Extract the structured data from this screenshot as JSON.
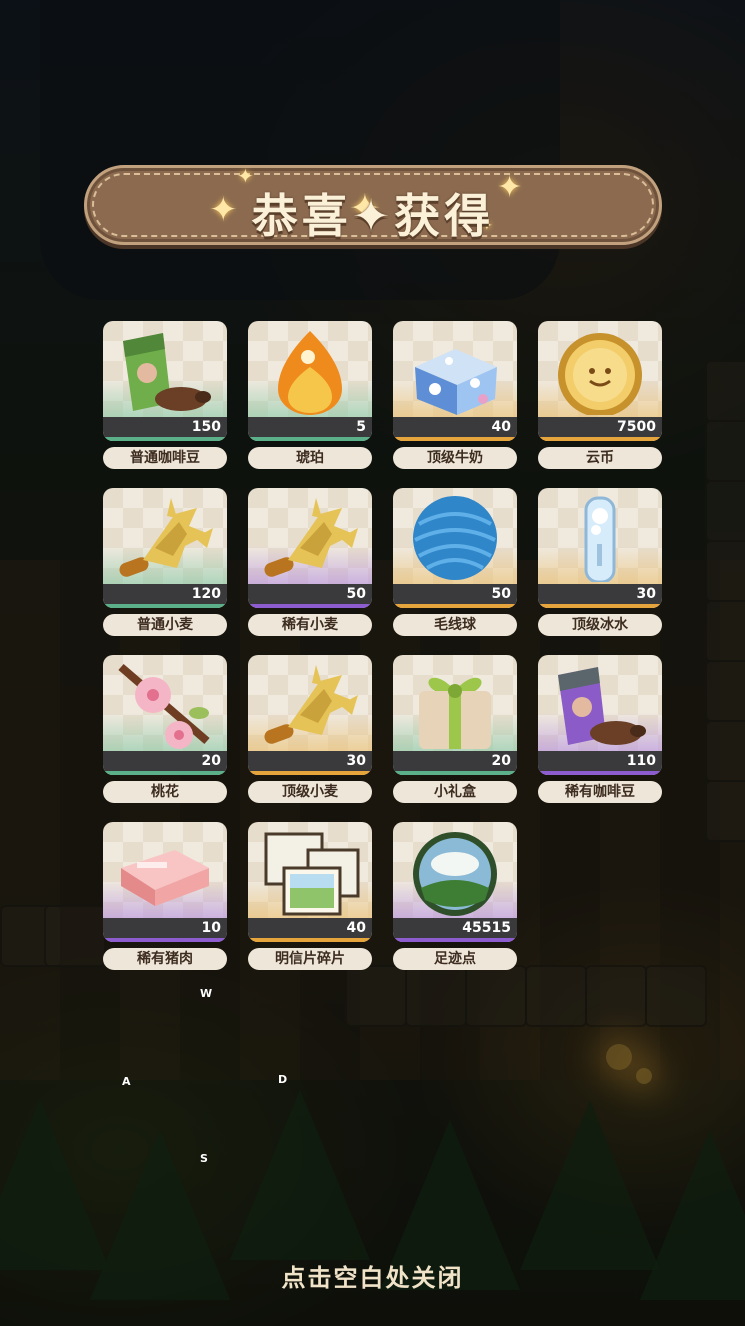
{
  "banner": {
    "title": "恭喜✦获得"
  },
  "rewards": [
    {
      "name": "普通咖啡豆",
      "qty": "150",
      "rarity": "green",
      "icon": "coffee-bean-bag-icon"
    },
    {
      "name": "琥珀",
      "qty": "5",
      "rarity": "green",
      "icon": "amber-icon"
    },
    {
      "name": "顶级牛奶",
      "qty": "40",
      "rarity": "gold",
      "icon": "milk-carton-icon"
    },
    {
      "name": "云币",
      "qty": "7500",
      "rarity": "gold",
      "icon": "cloud-coin-icon"
    },
    {
      "name": "普通小麦",
      "qty": "120",
      "rarity": "green",
      "icon": "wheat-icon"
    },
    {
      "name": "稀有小麦",
      "qty": "50",
      "rarity": "purple",
      "icon": "wheat-icon"
    },
    {
      "name": "毛线球",
      "qty": "50",
      "rarity": "gold",
      "icon": "yarn-ball-icon"
    },
    {
      "name": "顶级冰水",
      "qty": "30",
      "rarity": "gold",
      "icon": "ice-water-icon"
    },
    {
      "name": "桃花",
      "qty": "20",
      "rarity": "green",
      "icon": "peach-blossom-icon"
    },
    {
      "name": "顶级小麦",
      "qty": "30",
      "rarity": "gold",
      "icon": "wheat-icon"
    },
    {
      "name": "小礼盒",
      "qty": "20",
      "rarity": "green",
      "icon": "gift-box-icon"
    },
    {
      "name": "稀有咖啡豆",
      "qty": "110",
      "rarity": "purple",
      "icon": "coffee-bean-bag-icon"
    },
    {
      "name": "稀有猪肉",
      "qty": "10",
      "rarity": "purple",
      "icon": "pork-icon"
    },
    {
      "name": "明信片碎片",
      "qty": "40",
      "rarity": "gold",
      "icon": "postcard-fragment-icon"
    },
    {
      "name": "足迹点",
      "qty": "45515",
      "rarity": "purple",
      "icon": "footprint-point-icon"
    }
  ],
  "controls": {
    "up": "W",
    "left": "A",
    "right": "D",
    "down": "S"
  },
  "footer": {
    "close_hint": "点击空白处关闭"
  },
  "colors": {
    "green": "#5bb08a",
    "gold": "#e5a43c",
    "purple": "#8d5ccf",
    "banner": "#8b6a4f"
  }
}
